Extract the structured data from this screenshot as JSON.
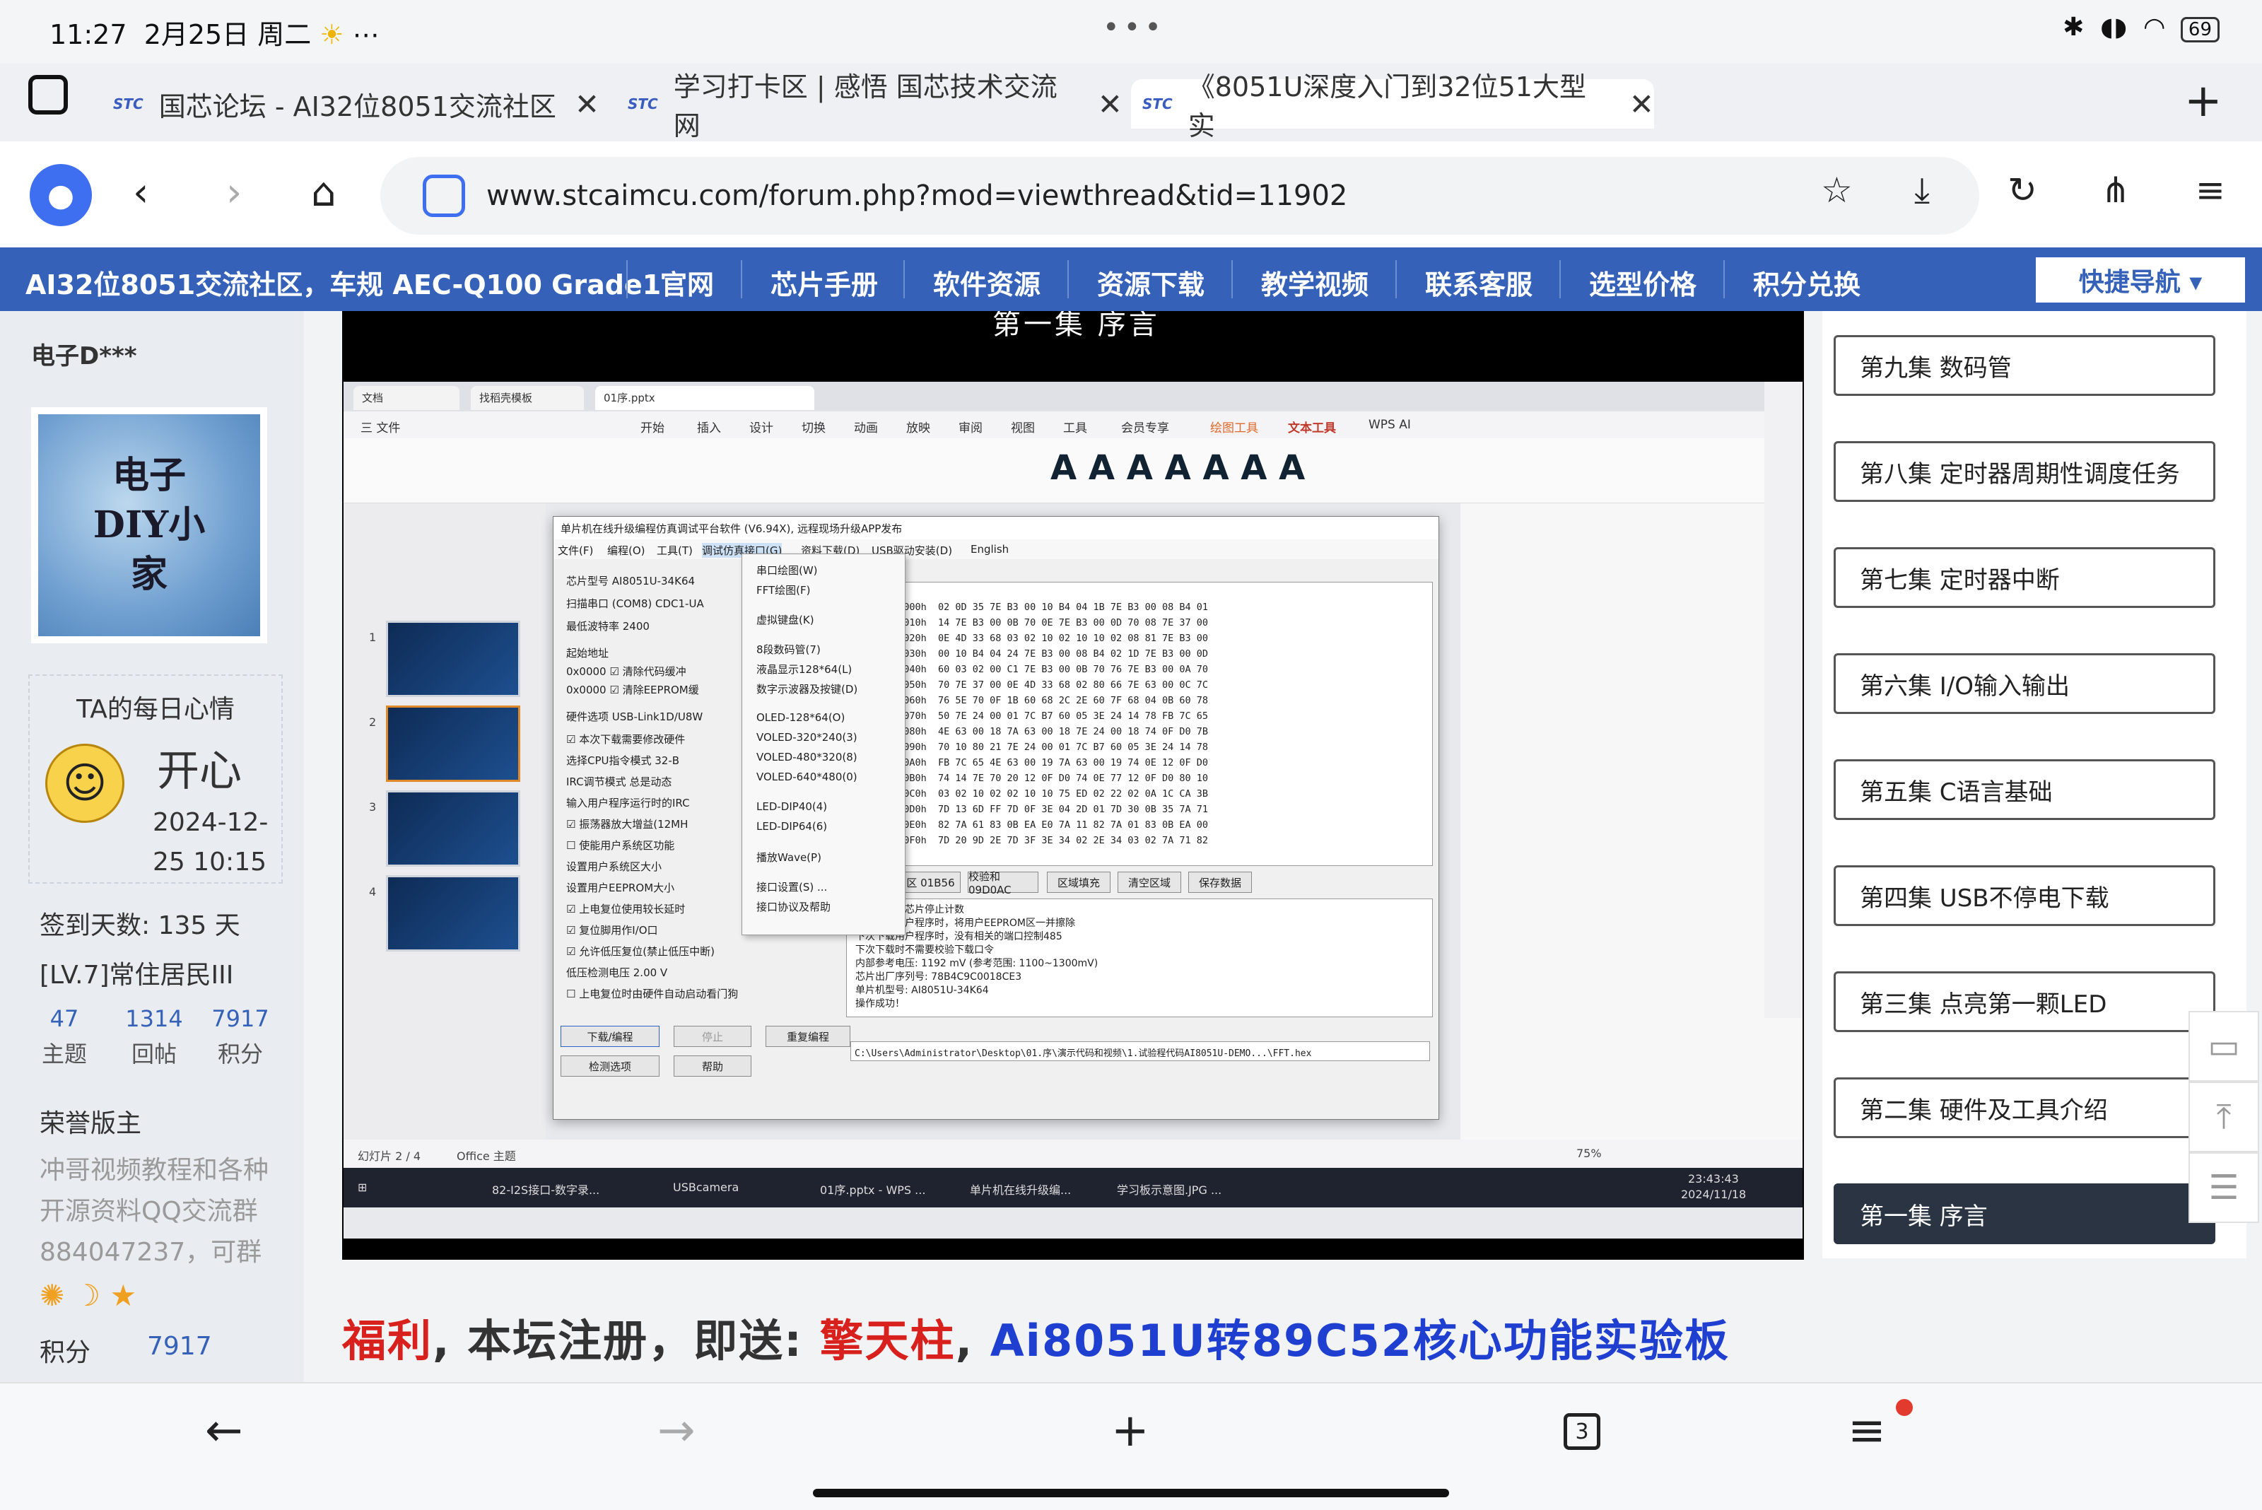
{
  "status": {
    "time": "11:27",
    "date": "2月25日 周二",
    "dots": "•••",
    "battery": "69"
  },
  "tabs": [
    {
      "favicon": "STC",
      "title": "国芯论坛 - AI32位8051交流社区"
    },
    {
      "favicon": "STC",
      "title": "学习打卡区 | 感悟 国芯技术交流网"
    },
    {
      "favicon": "STC",
      "title": "《8051U深度入门到32位51大型实"
    }
  ],
  "address": {
    "url": "www.stcaimcu.com/forum.php?mod=viewthread&tid=11902"
  },
  "forum_nav": {
    "brand": "AI32位8051交流社区，车规 AEC-Q100 Grade1",
    "items": [
      "官网",
      "芯片手册",
      "软件资源",
      "资源下载",
      "教学视频",
      "联系客服",
      "选型价格",
      "积分兑换"
    ],
    "quick_nav": "快捷导航 ▾"
  },
  "profile": {
    "username": "电子D***",
    "avatar_text": "电子DIY小家",
    "mood_title": "TA的每日心情",
    "mood_word": "开心",
    "mood_date_1": "2024-12-",
    "mood_date_2": "25 10:15",
    "signin": "签到天数: 135 天",
    "level": "[LV.7]常住居民III",
    "stats": [
      {
        "n": "47",
        "l": "主题"
      },
      {
        "n": "1314",
        "l": "回帖"
      },
      {
        "n": "7917",
        "l": "积分"
      }
    ],
    "honor": "荣誉版主",
    "desc_1": "冲哥视频教程和各种",
    "desc_2": "开源资料QQ交流群",
    "desc_3": "884047237，可群",
    "points_label": "积分",
    "points_value": "7917"
  },
  "video": {
    "caption": "第一集 序言",
    "wps_tabs": [
      "文档",
      "找稻壳模板",
      "01序.pptx"
    ],
    "wps_menu": [
      "三 文件",
      "开始",
      "插入",
      "设计",
      "切换",
      "动画",
      "放映",
      "审阅",
      "视图",
      "工具",
      "会员专享",
      "绘图工具",
      "文本工具",
      "WPS AI"
    ],
    "isp_title": "单片机在线升级编程仿真调试平台软件 (V6.94X), 远程现场升级APP发布",
    "isp_menu": [
      "文件(F)",
      "编程(O)",
      "工具(T)",
      "调试仿真接口(G)",
      "资料下载(D)",
      "USB驱动安装(D)",
      "English"
    ],
    "dropdown": [
      "串口绘图(W)",
      "FFT绘图(F)",
      "虚拟键盘(K)",
      "8段数码管(7)",
      "液晶显示128*64(L)",
      "数字示波器及按键(D)",
      "OLED-128*64(O)",
      "VOLED-320*240(3)",
      "VOLED-480*320(8)",
      "VOLED-640*480(0)",
      "LED-DIP40(4)",
      "LED-DIP64(6)",
      "播放Wave(P)",
      "接口设置(S) ...",
      "接口协议及帮助"
    ],
    "hex_lines": [
      "F0000h  02 0D 35 7E B3 00 10 B4 04 1B 7E B3 00 08 B4 01",
      "F0010h  14 7E B3 00 0B 70 0E 7E B3 00 0D 70 08 7E 37 00",
      "F0020h  0E 4D 33 68 03 02 10 02 10 10 02 08 81 7E B3 00",
      "F0030h  00 10 B4 04 24 7E B3 00 08 B4 02 1D 7E B3 00 0D",
      "F0040h  60 03 02 00 C1 7E B3 00 0B 70 76 7E B3 00 0A 70",
      "F0050h  70 7E 37 00 0E 4D 33 68 02 80 66 7E 63 00 0C 7C",
      "F0060h  76 5E 70 0F 1B 60 68 2C 2E 60 7F 68 04 0B 60 78",
      "F0070h  50 7E 24 00 01 7C B7 60 05 3E 24 14 78 FB 7C 65",
      "F0080h  4E 63 00 18 7A 63 00 18 7E 24 00 18 74 0F D0 7B",
      "F0090h  70 10 80 21 7E 24 00 01 7C B7 60 05 3E 24 14 78",
      "F00A0h  FB 7C 65 4E 63 00 19 7A 63 00 19 74 0E 12 0F D0",
      "F00B0h  74 14 7E 70 20 12 0F D0 74 0E 77 12 0F D0 80 10",
      "F00C0h  03 02 10 02 02 10 10 75 ED 02 22 02 0A 1C CA 3B",
      "F00D0h  7D 13 6D FF 7D 0F 3E 04 2D 01 7D 30 0B 35 7A 71",
      "F00E0h  82 7A 61 83 0B EA E0 7A 11 82 7A 01 83 0B EA 00",
      "F00F0h  7D 20 9D 2E 7D 3F 3E 34 02 2E 34 03 02 7A 71 82"
    ],
    "log_lines": [
      "检测到状态芯片停止计数",
      "下次下载用户程序时，将用户EEPROM区一并擦除",
      "下次下载用户程序时，没有相关的端口控制485",
      "下次下载时不需要校验下载口令",
      "内部参考电压: 1192 mV (参考范围: 1100~1300mV)",
      "芯片出厂序列号: 78B4C9C0018CE3",
      "单片机型号: AI8051U-34K64",
      "操作成功！"
    ],
    "buttons": [
      "下载/编程",
      "停止",
      "重复编程",
      "检测选项",
      "帮助"
    ],
    "path": "C:\\Users\\Administrator\\Desktop\\01.序\\演示代码和视频\\1.试验程代码AI8051U-DEMO...\\FFT.hex",
    "slide_count": "幻灯片 2 / 4",
    "theme": "Office 主题",
    "zoom": "75%",
    "clock": "23:43:43",
    "clock_date": "2024/11/18",
    "taskbar_items": [
      "82-I2S接口-数字录...",
      "USBcamera",
      "01序.pptx - WPS ...",
      "单片机在线升级编...",
      "学习板示意图.JPG ..."
    ]
  },
  "banner": {
    "part1": "福利",
    "part2": ", 本坛注册，即送: ",
    "part3": "擎天柱",
    "part4": ", ",
    "part5": "Ai8051U转89C52核心功能实验板"
  },
  "episodes": [
    "第九集 数码管",
    "第八集 定时器周期性调度任务",
    "第七集 定时器中断",
    "第六集 I/O输入输出",
    "第五集 C语言基础",
    "第四集 USB不停电下载",
    "第三集 点亮第一颗LED",
    "第二集 硬件及工具介绍",
    "第一集 序言"
  ],
  "bottom_nav": {
    "tab_count": "3"
  },
  "colors": {
    "forum_blue": "#3562b8",
    "red": "#d8201c",
    "blue": "#1f3fd0",
    "active_episode": "#2a3442"
  }
}
